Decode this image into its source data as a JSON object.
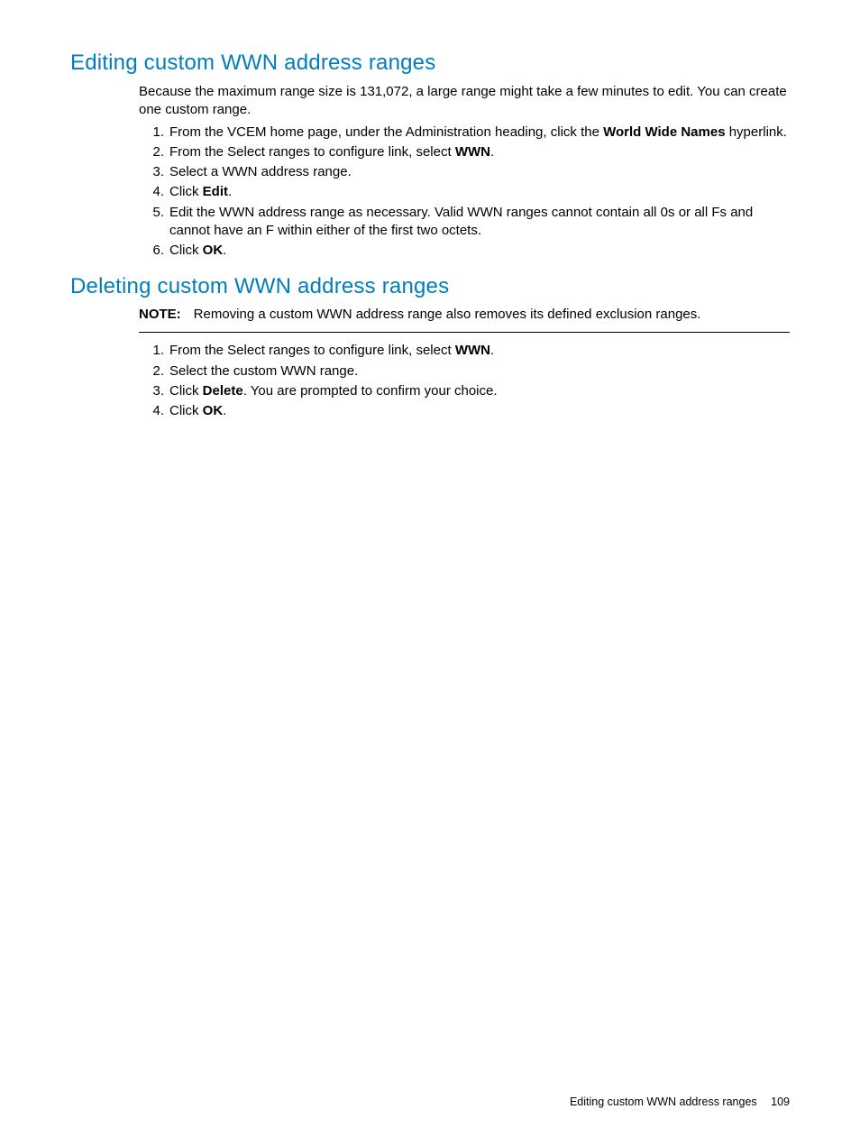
{
  "section1": {
    "heading": "Editing custom WWN address ranges",
    "intro": "Because the maximum range size is 131,072, a large range might take a few minutes to edit. You can create one custom range.",
    "steps": [
      {
        "num": "1.",
        "pre": "From the VCEM home page, under the Administration heading, click the ",
        "bold": "World Wide Names",
        "post": " hyperlink."
      },
      {
        "num": "2.",
        "pre": "From the Select ranges to configure link, select ",
        "bold": "WWN",
        "post": "."
      },
      {
        "num": "3.",
        "pre": "Select a WWN address range.",
        "bold": "",
        "post": ""
      },
      {
        "num": "4.",
        "pre": "Click ",
        "bold": "Edit",
        "post": "."
      },
      {
        "num": "5.",
        "pre": "Edit the WWN address range as necessary. Valid WWN ranges cannot contain all 0s or all Fs and cannot have an F within either of the first two octets.",
        "bold": "",
        "post": ""
      },
      {
        "num": "6.",
        "pre": "Click ",
        "bold": "OK",
        "post": "."
      }
    ]
  },
  "section2": {
    "heading": "Deleting custom WWN address ranges",
    "note_label": "NOTE:",
    "note_text": "Removing a custom WWN address range also removes its defined exclusion ranges.",
    "steps": [
      {
        "num": "1.",
        "pre": "From the Select ranges to configure link, select ",
        "bold": "WWN",
        "post": "."
      },
      {
        "num": "2.",
        "pre": "Select the custom WWN range.",
        "bold": "",
        "post": ""
      },
      {
        "num": "3.",
        "pre": "Click ",
        "bold": "Delete",
        "post": ". You are prompted to confirm your choice."
      },
      {
        "num": "4.",
        "pre": "Click ",
        "bold": "OK",
        "post": "."
      }
    ]
  },
  "footer": {
    "text": "Editing custom WWN address ranges",
    "page": "109"
  }
}
